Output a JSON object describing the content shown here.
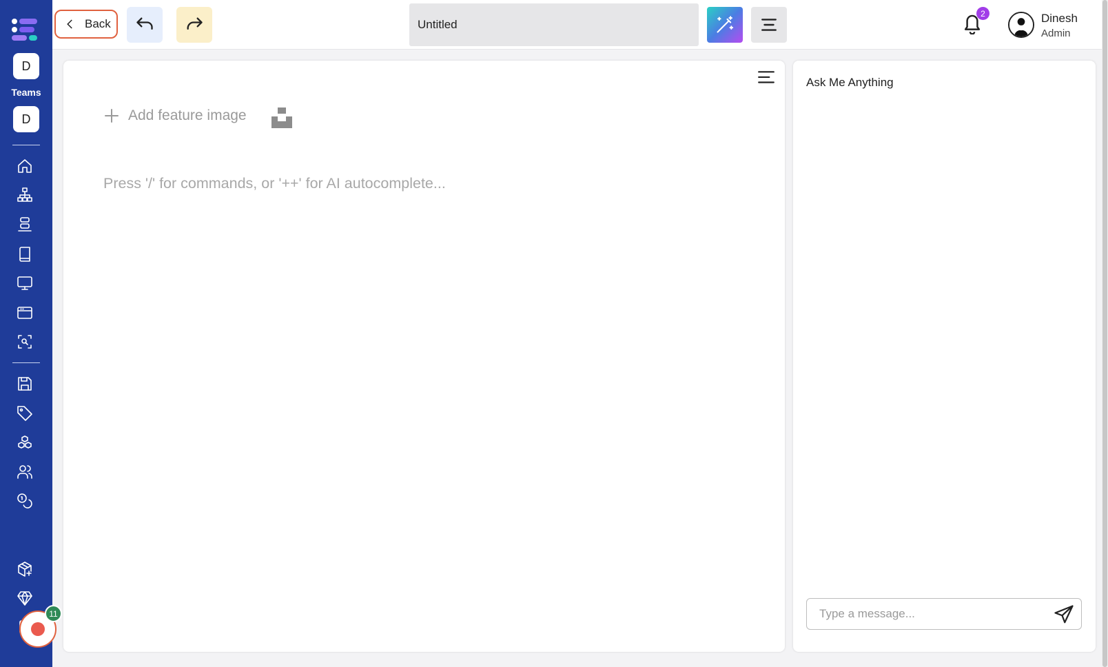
{
  "sidebar": {
    "team_badges": [
      "D",
      "D"
    ],
    "teams_label": "Teams",
    "nav_icons": [
      "home-icon",
      "sitemap-icon",
      "stack-icon",
      "book-icon",
      "monitor-icon",
      "browser-window-icon",
      "scan-search-icon"
    ],
    "secondary_icons": [
      "save-icon",
      "tag-icon",
      "cubes-icon",
      "users-icon",
      "coins-icon"
    ],
    "bottom_icons": [
      "package-plus-icon",
      "diamond-icon",
      "clipboard-icon"
    ],
    "record_count": "11"
  },
  "topbar": {
    "back_label": "Back",
    "title_value": "Untitled",
    "notification_count": "2",
    "user_name": "Dinesh",
    "user_role": "Admin"
  },
  "editor": {
    "add_feature_label": "Add feature image",
    "placeholder": "Press '/' for commands, or '++' for AI autocomplete..."
  },
  "ai_panel": {
    "title": "Ask Me Anything",
    "input_placeholder": "Type a message..."
  },
  "colors": {
    "sidebar": "#1f3c99",
    "back_border": "#e0613f",
    "undo_bg": "#e6eefc",
    "redo_bg": "#fbefc9",
    "badge_purple": "#a13de8",
    "record_badge": "#2f8a57"
  }
}
